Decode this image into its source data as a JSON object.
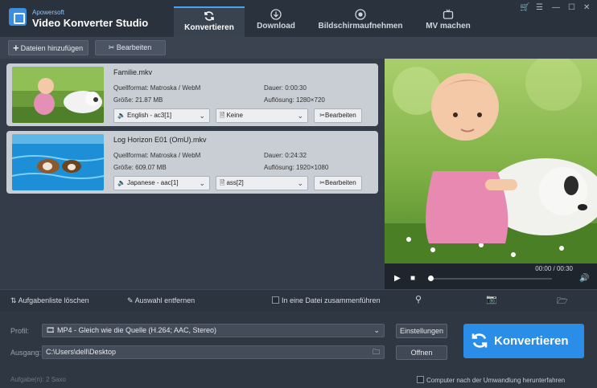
{
  "app": {
    "brand_small": "Apowersoft",
    "brand_title": "Video Konverter Studio"
  },
  "tabs": [
    {
      "label": "Konvertieren",
      "icon": "refresh-icon",
      "active": true
    },
    {
      "label": "Download",
      "icon": "download-icon"
    },
    {
      "label": "Bildschirmaufnehmen",
      "icon": "record-icon"
    },
    {
      "label": "MV machen",
      "icon": "tv-icon"
    }
  ],
  "window_controls": [
    "cart-icon",
    "list-icon",
    "minimize-icon",
    "maximize-icon",
    "close-icon"
  ],
  "toolbar": {
    "add_files": "Dateien hinzufügen",
    "edit": "Bearbeiten"
  },
  "files": [
    {
      "name": "Familie.mkv",
      "source_format": "Quellformat: Matroska / WebM",
      "size": "Größe: 21.87 MB",
      "duration": "Dauer: 0:00:30",
      "resolution": "Auflösung: 1280×720",
      "audio": "English - ac3[1]",
      "subtitle": "Keine",
      "edit_label": "Bearbeiten"
    },
    {
      "name": "Log Horizon E01 (OmU).mkv",
      "source_format": "Quellformat: Matroska / WebM",
      "size": "Größe: 609.07 MB",
      "duration": "Dauer: 0:24:32",
      "resolution": "Auflösung: 1920×1080",
      "audio": "Japanese - aac[1]",
      "subtitle": "ass[2]",
      "edit_label": "Bearbeiten"
    }
  ],
  "player": {
    "time": "00:00 / 00:30",
    "progress": 0.0
  },
  "actions": {
    "clear_list": "Aufgabenliste löschen",
    "remove_selection": "Auswahl entfernen",
    "merge": "In eine Datei zusammenführen"
  },
  "output": {
    "profile_label": "Profil:",
    "profile_value": "MP4 - Gleich wie die Quelle (H.264; AAC, Stereo)",
    "settings_button": "Einstellungen",
    "path_label": "Ausgang:",
    "path_value": "C:\\Users\\dell\\Desktop",
    "open_button": "Offnen",
    "convert_button": "Konvertieren"
  },
  "status": {
    "tasks": "Aufgabe(n): 2 Saxo",
    "shutdown": "Computer nach der Umwandlung herunterfahren"
  },
  "colors": {
    "accent": "#2a8ee8",
    "background": "#2c3440",
    "card": "#c9ced4"
  }
}
